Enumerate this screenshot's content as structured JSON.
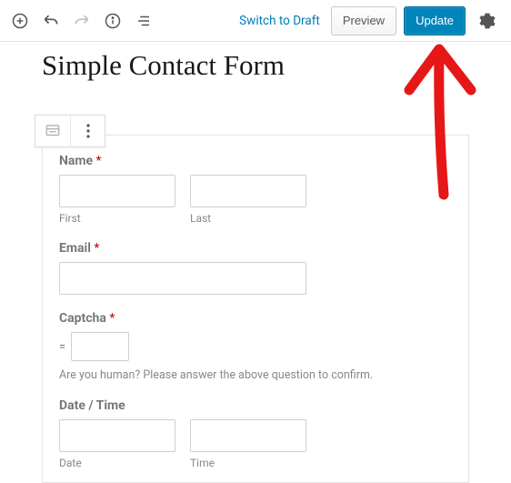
{
  "toolbar": {
    "switch_to_draft": "Switch to Draft",
    "preview": "Preview",
    "update": "Update"
  },
  "page": {
    "title": "Simple Contact Form"
  },
  "form": {
    "name": {
      "label": "Name",
      "required": "*",
      "first": {
        "value": "",
        "sublabel": "First"
      },
      "last": {
        "value": "",
        "sublabel": "Last"
      }
    },
    "email": {
      "label": "Email",
      "required": "*",
      "value": ""
    },
    "captcha": {
      "label": "Captcha",
      "required": "*",
      "eq_prefix": "=",
      "value": "",
      "helper": "Are you human? Please answer the above question to confirm."
    },
    "datetime": {
      "label": "Date / Time",
      "date": {
        "value": "",
        "sublabel": "Date"
      },
      "time": {
        "value": "",
        "sublabel": "Time"
      }
    }
  }
}
